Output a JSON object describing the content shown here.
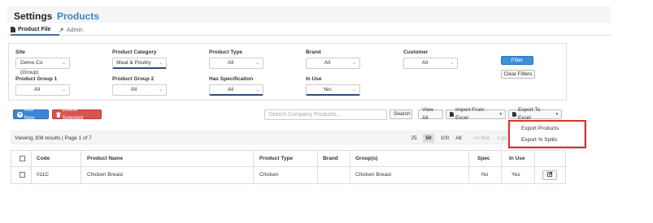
{
  "header": {
    "title": "Settings",
    "subtitle": "Products"
  },
  "tabs": [
    {
      "label": "Product File",
      "icon": "file-icon"
    },
    {
      "label": "Admin",
      "icon": "wrench-icon"
    }
  ],
  "filters": {
    "site": {
      "label": "Site",
      "value": "Demo Co (Group)"
    },
    "product_category": {
      "label": "Product Category",
      "value": "Meat & Poultry"
    },
    "product_type": {
      "label": "Product Type",
      "value": "All"
    },
    "brand": {
      "label": "Brand",
      "value": "All"
    },
    "customer": {
      "label": "Customer",
      "value": "All"
    },
    "product_group_1": {
      "label": "Product Group 1",
      "value": "All"
    },
    "product_group_2": {
      "label": "Product Group 2",
      "value": "All"
    },
    "has_specification": {
      "label": "Has Specification",
      "value": "All"
    },
    "in_use": {
      "label": "In Use",
      "value": "Yes"
    },
    "filter_button": "Filter",
    "clear_button": "Clear Filters"
  },
  "toolbar": {
    "add_new": "Add New",
    "delete_selected": "Delete Selected",
    "search_placeholder": "Search Company Products...",
    "search_button": "Search",
    "view_all": "View All",
    "import_excel": "Import From Excel",
    "export_excel": "Export To Excel"
  },
  "export_menu": [
    "Export Products",
    "Export % Splits"
  ],
  "results": {
    "summary": "Viewing 308 results | Page 1 of 7",
    "page_sizes": [
      "25",
      "50",
      "100",
      "All"
    ],
    "active_page_size": "50",
    "nav": [
      "<< first",
      "< pr"
    ]
  },
  "table": {
    "columns": [
      "Code",
      "Product Name",
      "Product Type",
      "Brand",
      "Group(s)",
      "Spec",
      "In Use"
    ],
    "rows": [
      {
        "code": "011C",
        "product_name": "Chicken Breast",
        "product_type": "Chicken",
        "brand": "",
        "groups": "Chicken Breast",
        "spec": "No",
        "in_use": "Yes"
      }
    ]
  },
  "colors": {
    "accent": "#3a83c8",
    "primary_button": "#3a86d4",
    "danger_button": "#d9534f",
    "highlight_border": "#e03030"
  }
}
